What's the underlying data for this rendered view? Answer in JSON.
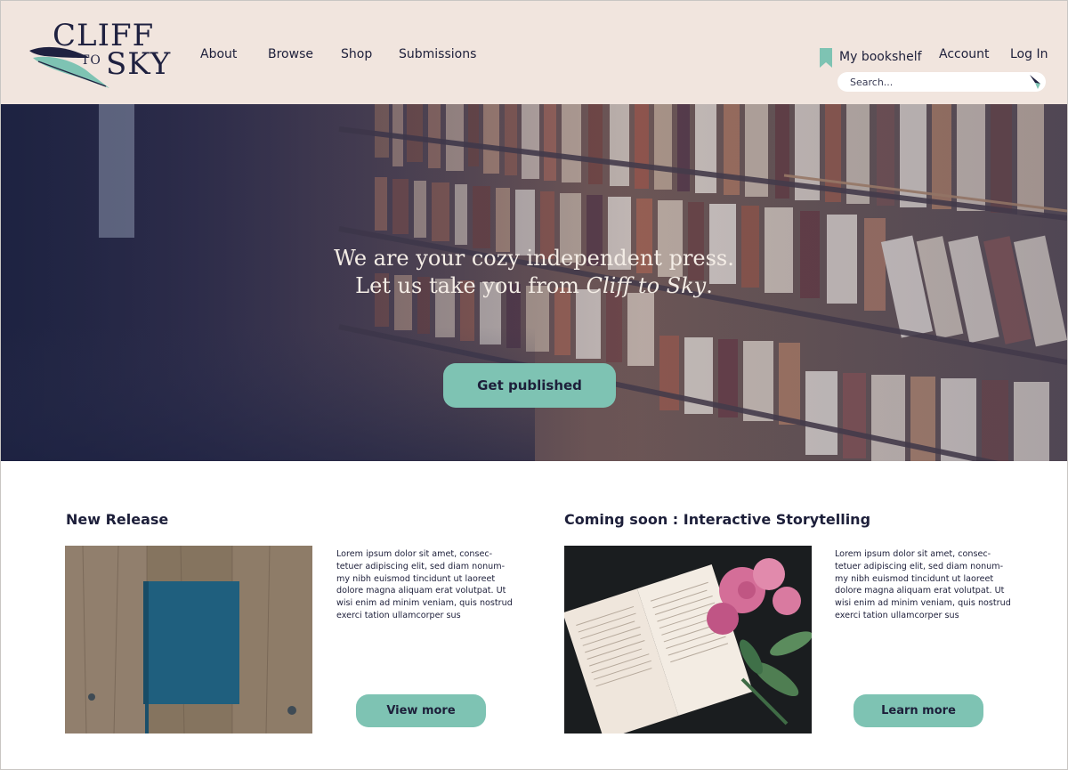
{
  "brand": {
    "logo_line1": "CLIFF",
    "logo_to": "TO",
    "logo_line2": "SKY"
  },
  "nav": {
    "about": "About",
    "browse": "Browse",
    "shop": "Shop",
    "submissions": "Submissions"
  },
  "user_nav": {
    "bookshelf": "My bookshelf",
    "account": "Account",
    "login": "Log In"
  },
  "search": {
    "placeholder": "Search..."
  },
  "hero": {
    "line1": "We are your cozy independent press.",
    "line2_prefix": "Let us take you from ",
    "line2_em": "Cliff to Sky",
    "line2_suffix": ".",
    "cta": "Get published"
  },
  "sections": {
    "new_release": {
      "title": "New Release",
      "body": "Lorem ipsum dolor sit amet, consec-tetuer adipiscing elit, sed diam nonum-my nibh euismod tincidunt ut laoreet dolore magna aliquam erat volutpat. Ut wisi enim ad minim veniam, quis nostrud exerci tation ullamcorper sus",
      "cta": "View more"
    },
    "coming_soon": {
      "title": "Coming soon : Interactive Storytelling",
      "body": "Lorem ipsum dolor sit amet, consec-tetuer adipiscing elit, sed diam nonum-my nibh euismod tincidunt ut laoreet dolore magna aliquam erat volutpat. Ut wisi enim ad minim veniam, quis nostrud exerci tation ullamcorper sus",
      "cta": "Learn more"
    }
  },
  "colors": {
    "header_bg": "#f1e5de",
    "accent_teal": "#7ec3b3",
    "navy_text": "#1d1f3a"
  }
}
